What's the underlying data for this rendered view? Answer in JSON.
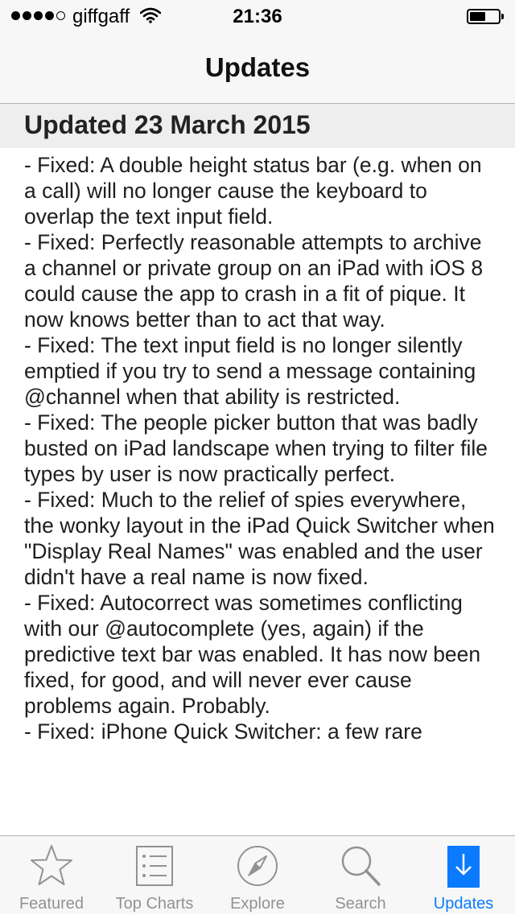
{
  "status_bar": {
    "carrier": "giffgaff",
    "time": "21:36",
    "signal_icon": "signal-dots-icon",
    "wifi_icon": "wifi-icon",
    "battery_icon": "battery-icon",
    "battery_level": 0.55
  },
  "nav": {
    "title": "Updates"
  },
  "section": {
    "header": "Updated 23 March 2015"
  },
  "release_notes": [
    "- Fixed: A double height status bar (e.g. when on a call) will no longer cause the keyboard to overlap the text input field.",
    "- Fixed: Perfectly reasonable attempts to archive a channel or private group on an iPad with iOS 8 could cause the app to crash in a fit of pique. It now knows better than to act that way.",
    "- Fixed: The text input field is no longer silently emptied if you try to send a message containing @channel when that ability is restricted.",
    "- Fixed: The people picker button that was badly busted on iPad landscape when trying to filter file types by user is now practically perfect.",
    "- Fixed: Much to the relief of spies everywhere, the wonky layout in the iPad Quick Switcher when \"Display Real Names\" was enabled and the user didn't have a real name is now fixed.",
    "- Fixed: Autocorrect was sometimes conflicting with our @autocomplete (yes, again) if the predictive text bar was enabled. It has now been fixed, for good, and will never ever cause problems again. Probably.",
    "- Fixed: iPhone Quick Switcher: a few rare"
  ],
  "tab_bar": {
    "tabs": [
      {
        "label": "Featured",
        "icon": "star-icon",
        "active": false
      },
      {
        "label": "Top Charts",
        "icon": "list-icon",
        "active": false
      },
      {
        "label": "Explore",
        "icon": "compass-icon",
        "active": false
      },
      {
        "label": "Search",
        "icon": "search-icon",
        "active": false
      },
      {
        "label": "Updates",
        "icon": "download-icon",
        "active": true
      }
    ]
  },
  "colors": {
    "accent": "#0a7aff",
    "inactive_tab": "#929292",
    "bar_background": "#f7f7f7",
    "section_background": "#eeeeee"
  }
}
